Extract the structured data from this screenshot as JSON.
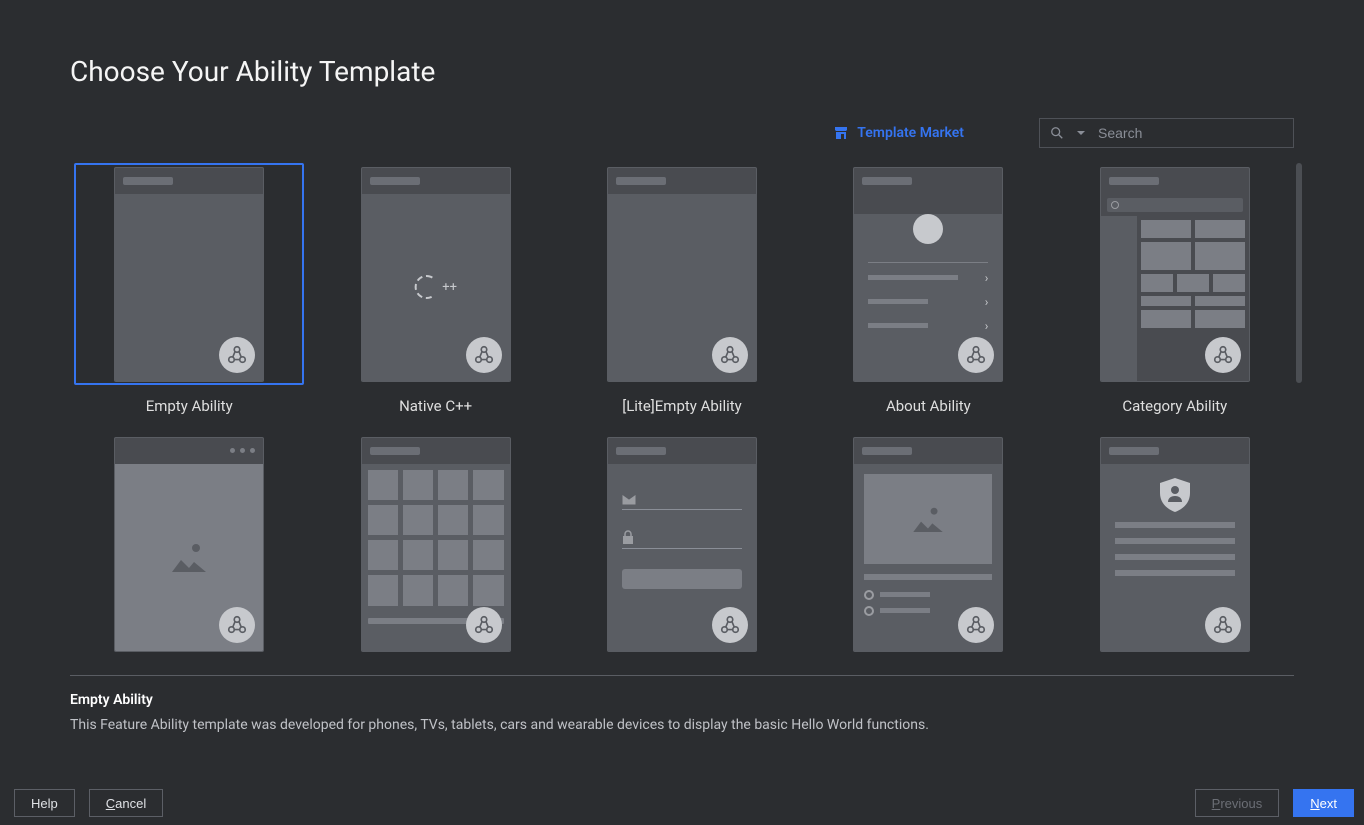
{
  "page_title": "Choose Your Ability Template",
  "template_market_label": "Template Market",
  "search_placeholder": "Search",
  "templates": [
    {
      "name": "Empty Ability",
      "selected": true
    },
    {
      "name": "Native C++"
    },
    {
      "name": "[Lite]Empty Ability"
    },
    {
      "name": "About Ability"
    },
    {
      "name": "Category Ability"
    },
    {
      "name": ""
    },
    {
      "name": ""
    },
    {
      "name": ""
    },
    {
      "name": ""
    },
    {
      "name": ""
    }
  ],
  "selected": {
    "title": "Empty Ability",
    "description": "This Feature Ability template was developed for phones, TVs, tablets, cars and wearable devices to display the basic Hello World functions."
  },
  "footer": {
    "help": "Help",
    "cancel": "Cancel",
    "previous": "Previous",
    "next": "Next"
  },
  "colors": {
    "accent": "#3574f0",
    "bg": "#2b2d30"
  }
}
